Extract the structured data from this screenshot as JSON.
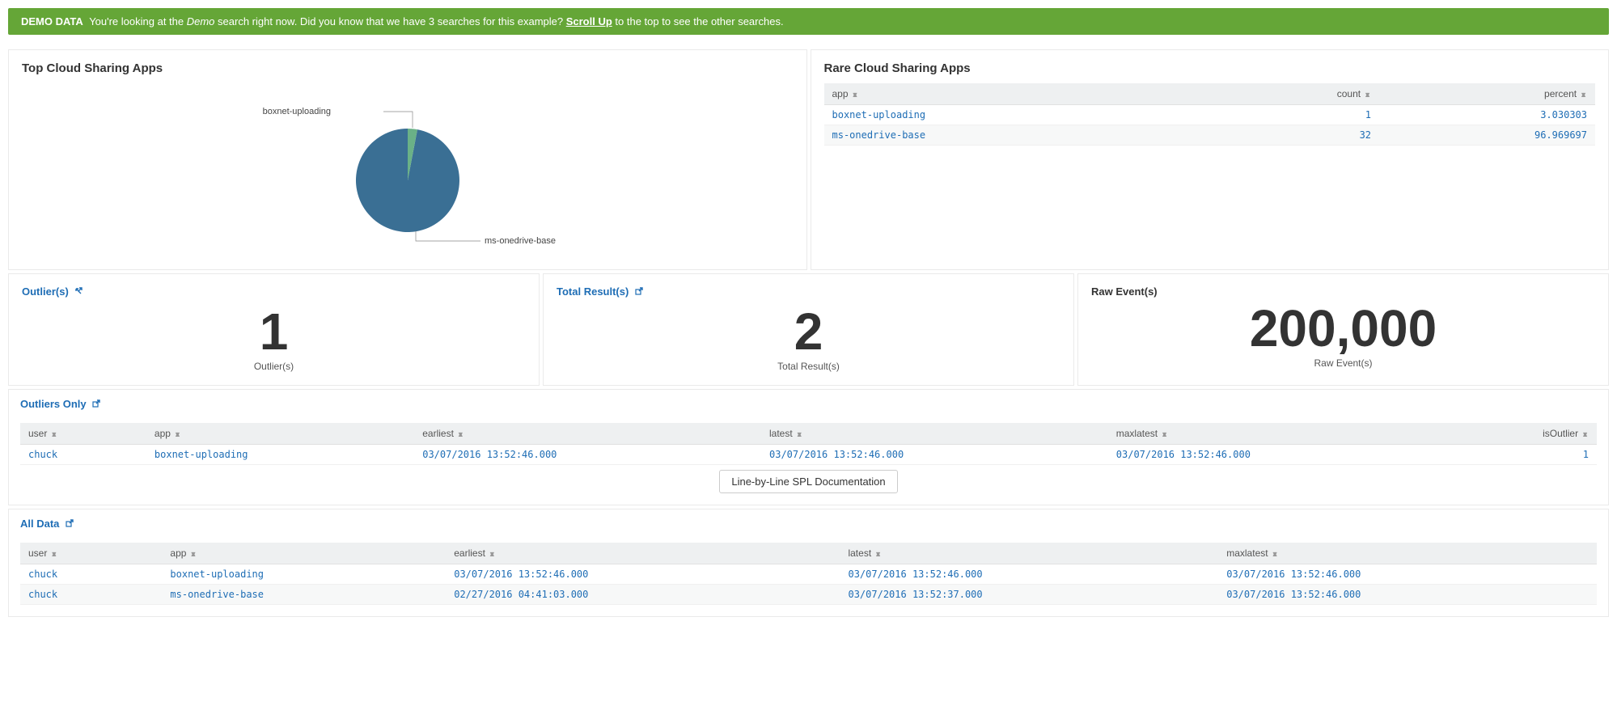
{
  "banner": {
    "prefix": "DEMO DATA",
    "text_before_demo": "You're looking at the ",
    "demo_word": "Demo",
    "text_after_demo": " search right now. Did you know that we have 3 searches for this example? ",
    "scroll_link": "Scroll Up",
    "text_after_link": " to the top to see the other searches."
  },
  "top_cloud": {
    "title": "Top Cloud Sharing Apps"
  },
  "chart_data": {
    "type": "pie",
    "title": "Top Cloud Sharing Apps",
    "slices": [
      {
        "name": "boxnet-uploading",
        "value": 1,
        "percent": 3.030303,
        "color": "#6ab187"
      },
      {
        "name": "ms-onedrive-base",
        "value": 32,
        "percent": 96.969697,
        "color": "#3a6f94"
      }
    ]
  },
  "rare_cloud": {
    "title": "Rare Cloud Sharing Apps",
    "headers": {
      "app": "app",
      "count": "count",
      "percent": "percent"
    },
    "rows": [
      {
        "app": "boxnet-uploading",
        "count": "1",
        "percent": "3.030303"
      },
      {
        "app": "ms-onedrive-base",
        "count": "32",
        "percent": "96.969697"
      }
    ]
  },
  "stats": {
    "outliers_title": "Outlier(s)",
    "outliers_value": "1",
    "outliers_sub": "Outlier(s)",
    "total_title": "Total Result(s)",
    "total_value": "2",
    "total_sub": "Total Result(s)",
    "raw_title": "Raw Event(s)",
    "raw_value": "200,000",
    "raw_sub": "Raw Event(s)"
  },
  "outliers_only": {
    "title": "Outliers Only",
    "headers": {
      "user": "user",
      "app": "app",
      "earliest": "earliest",
      "latest": "latest",
      "maxlatest": "maxlatest",
      "isOutlier": "isOutlier"
    },
    "rows": [
      {
        "user": "chuck",
        "app": "boxnet-uploading",
        "earliest": "03/07/2016 13:52:46.000",
        "latest": "03/07/2016 13:52:46.000",
        "maxlatest": "03/07/2016 13:52:46.000",
        "isOutlier": "1"
      }
    ],
    "doc_button": "Line-by-Line SPL Documentation"
  },
  "all_data": {
    "title": "All Data",
    "headers": {
      "user": "user",
      "app": "app",
      "earliest": "earliest",
      "latest": "latest",
      "maxlatest": "maxlatest"
    },
    "rows": [
      {
        "user": "chuck",
        "app": "boxnet-uploading",
        "earliest": "03/07/2016 13:52:46.000",
        "latest": "03/07/2016 13:52:46.000",
        "maxlatest": "03/07/2016 13:52:46.000"
      },
      {
        "user": "chuck",
        "app": "ms-onedrive-base",
        "earliest": "02/27/2016 04:41:03.000",
        "latest": "03/07/2016 13:52:37.000",
        "maxlatest": "03/07/2016 13:52:46.000"
      }
    ]
  }
}
